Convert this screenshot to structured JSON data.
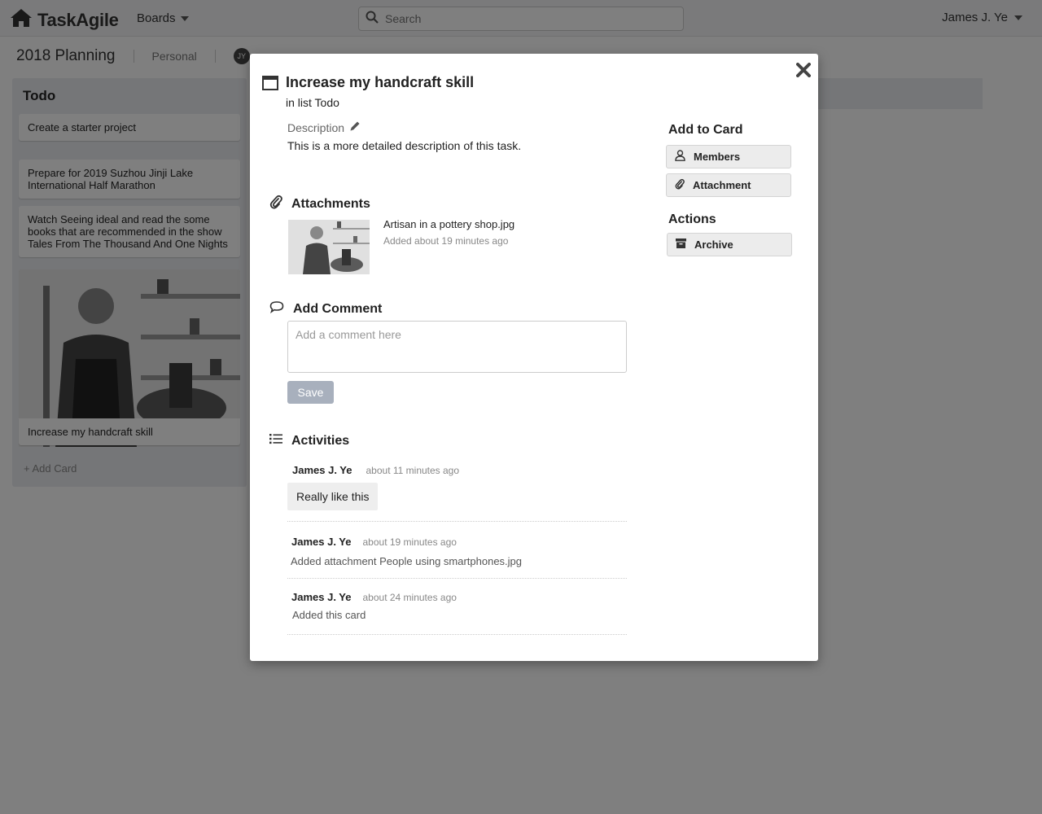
{
  "header": {
    "logo_text": "TaskAgile",
    "boards_label": "Boards",
    "search_placeholder": "Search",
    "user_name": "James J. Ye"
  },
  "board": {
    "name": "2018 Planning",
    "team": "Personal",
    "member_initials": "JY"
  },
  "list": {
    "title": "Todo",
    "cards": [
      "Create a starter project",
      "Prepare for 2019 Suzhou Jinji Lake International Half Marathon",
      "Watch Seeing ideal and read the some books that are recommended in the show Tales From The Thousand And One Nights",
      "Increase my handcraft skill"
    ],
    "add_card_label": "+ Add Card"
  },
  "modal": {
    "title": "Increase my handcraft skill",
    "in_list": "in list Todo",
    "description_label": "Description",
    "description": "This is a more detailed description of this task.",
    "attachments_heading": "Attachments",
    "attachment": {
      "name": "Artisan in a pottery shop.jpg",
      "meta": "Added about 19 minutes ago"
    },
    "add_comment_heading": "Add Comment",
    "comment_placeholder": "Add a comment here",
    "save_label": "Save",
    "activities_heading": "Activities",
    "activities": [
      {
        "user": "James J. Ye",
        "time": "about 11 minutes ago",
        "text": "Really like this"
      },
      {
        "user": "James J. Ye",
        "time": "about 19 minutes ago",
        "text": "Added attachment People using smartphones.jpg"
      },
      {
        "user": "James J. Ye",
        "time": "about 24 minutes ago",
        "text": "Added this card"
      }
    ],
    "sidebar": {
      "add_to_card_heading": "Add to Card",
      "members_label": "Members",
      "attachment_label": "Attachment",
      "actions_heading": "Actions",
      "archive_label": "Archive"
    }
  },
  "icons": {
    "logo": "home-icon",
    "search": "search-icon",
    "close": "close-icon",
    "card": "card-icon",
    "edit": "pencil-icon",
    "attachment": "paperclip-icon",
    "comment": "speech-bubble-icon",
    "activities": "list-icon",
    "members": "user-icon",
    "archive": "archive-icon"
  }
}
